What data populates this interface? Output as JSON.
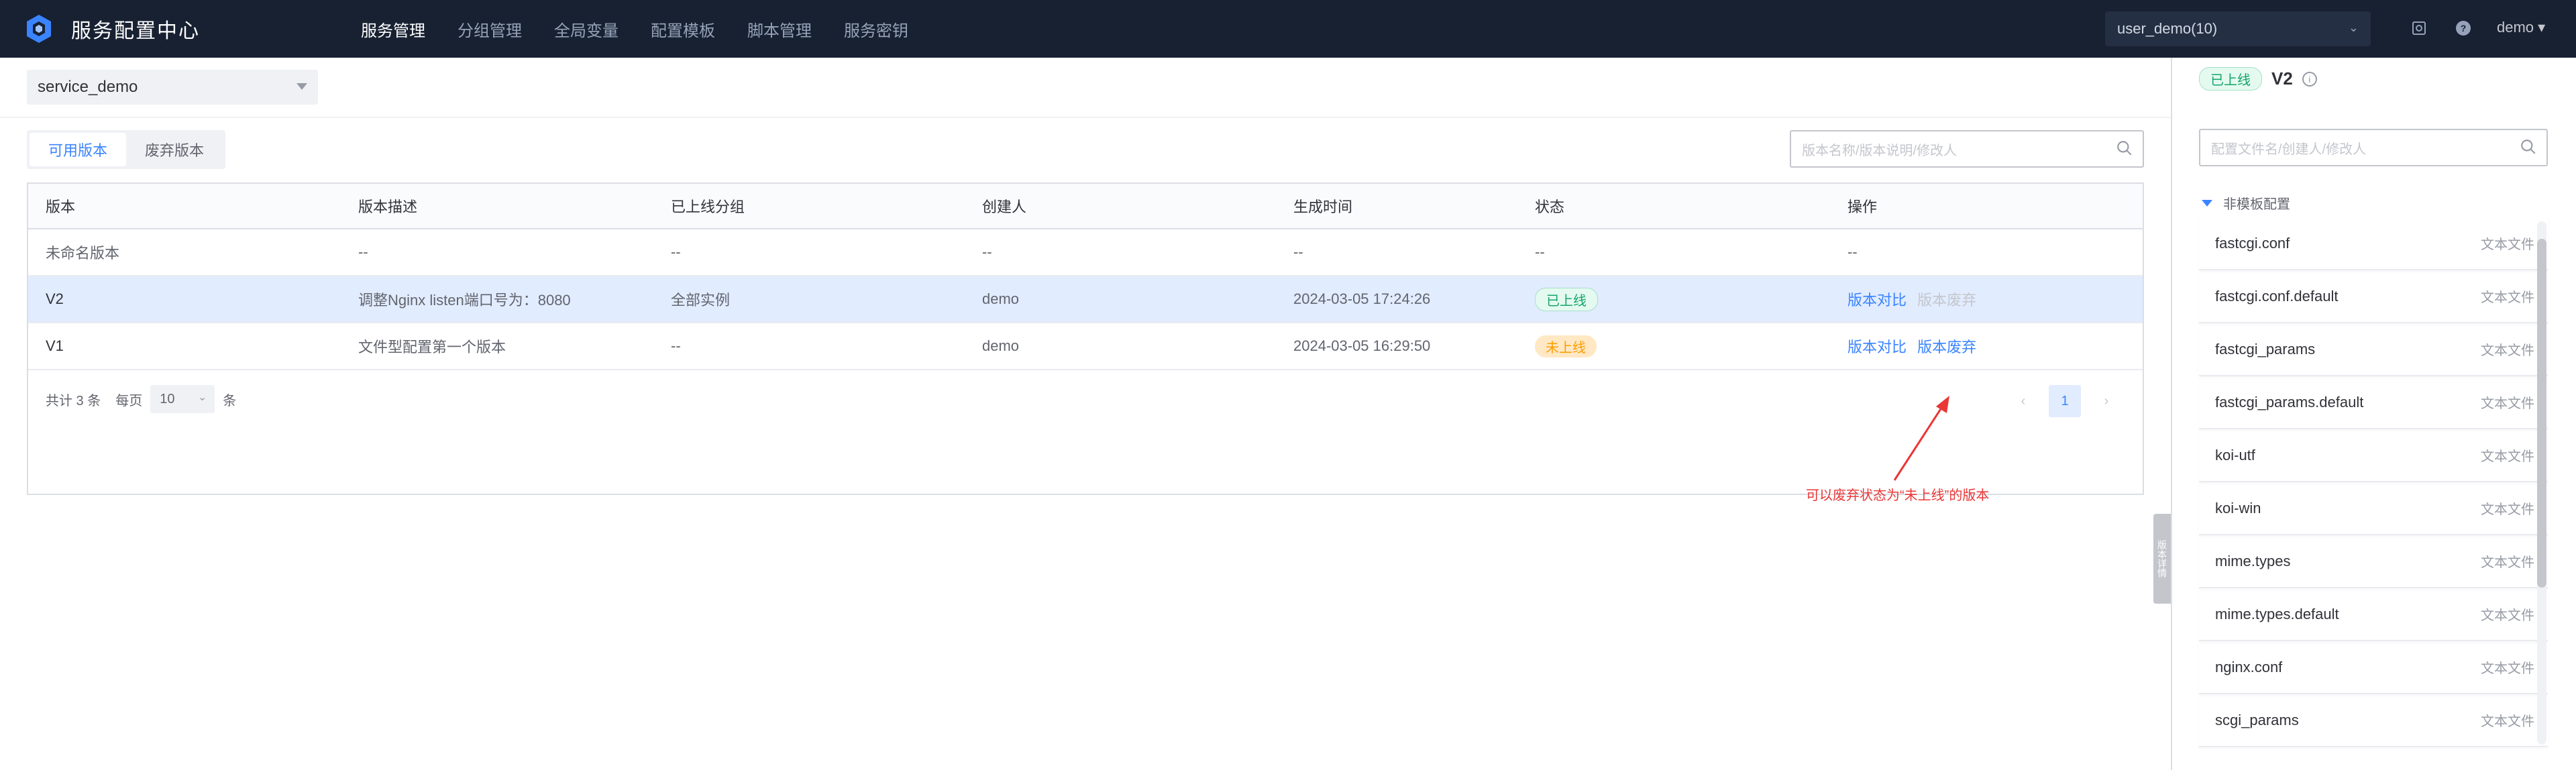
{
  "app": {
    "title": "服务配置中心"
  },
  "nav": {
    "items": [
      "服务管理",
      "分组管理",
      "全局变量",
      "配置模板",
      "脚本管理",
      "服务密钥"
    ]
  },
  "topbar": {
    "business": "user_demo(10)",
    "user": "demo"
  },
  "service": {
    "selected": "service_demo"
  },
  "tabs": [
    "可用版本",
    "废弃版本"
  ],
  "search": {
    "placeholder": "版本名称/版本说明/修改人"
  },
  "table": {
    "headers": [
      "版本",
      "版本描述",
      "已上线分组",
      "创建人",
      "生成时间",
      "状态",
      "操作"
    ],
    "rows": [
      {
        "version": "未命名版本",
        "desc": "--",
        "groups": "--",
        "creator": "--",
        "time": "--",
        "status": "--",
        "ops": [
          "--"
        ]
      },
      {
        "version": "V2",
        "desc": "调整Nginx listen端口号为：8080",
        "groups": "全部实例",
        "creator": "demo",
        "time": "2024-03-05 17:24:26",
        "status": "已上线",
        "ops": [
          "版本对比",
          "版本废弃"
        ]
      },
      {
        "version": "V1",
        "desc": "文件型配置第一个版本",
        "groups": "--",
        "creator": "demo",
        "time": "2024-03-05 16:29:50",
        "status": "未上线",
        "ops": [
          "版本对比",
          "版本废弃"
        ]
      }
    ]
  },
  "pager": {
    "total": "共计 3 条",
    "per_page_label": "每页",
    "per_page": "10",
    "unit": "条",
    "current": "1"
  },
  "annotation": "可以废弃状态为“未上线”的版本",
  "panel": {
    "status": "已上线",
    "version": "V2",
    "handle": "版本详情",
    "search_placeholder": "配置文件名/创建人/修改人",
    "group": "非模板配置",
    "files": [
      {
        "name": "fastcgi.conf",
        "type": "文本文件"
      },
      {
        "name": "fastcgi.conf.default",
        "type": "文本文件"
      },
      {
        "name": "fastcgi_params",
        "type": "文本文件"
      },
      {
        "name": "fastcgi_params.default",
        "type": "文本文件"
      },
      {
        "name": "koi-utf",
        "type": "文本文件"
      },
      {
        "name": "koi-win",
        "type": "文本文件"
      },
      {
        "name": "mime.types",
        "type": "文本文件"
      },
      {
        "name": "mime.types.default",
        "type": "文本文件"
      },
      {
        "name": "nginx.conf",
        "type": "文本文件"
      },
      {
        "name": "scgi_params",
        "type": "文本文件"
      }
    ]
  },
  "colors": {
    "primary": "#3a84ff",
    "header_bg": "#182132",
    "success": "#14a568",
    "warning": "#fe9c00",
    "danger": "#ea3636"
  }
}
